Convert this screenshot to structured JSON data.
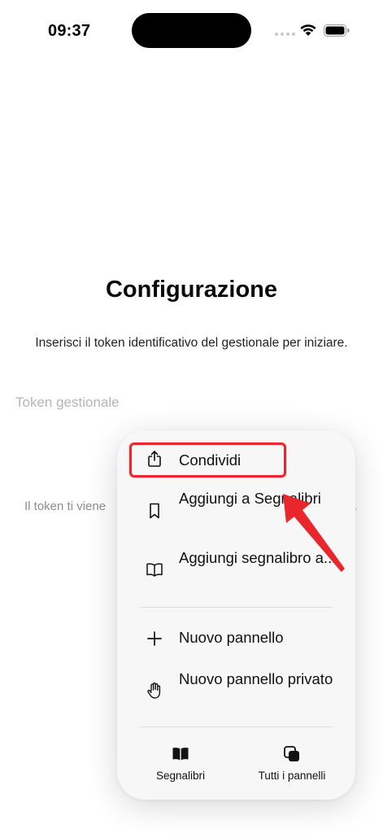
{
  "status_bar": {
    "time": "09:37",
    "icons": [
      "cellular-signal-icon",
      "wifi-icon",
      "battery-icon"
    ]
  },
  "page": {
    "title": "Configurazione",
    "subtitle": "Inserisci il token identificativo del gestionale per iniziare.",
    "token_input": {
      "placeholder": "Token gestionale",
      "value": ""
    },
    "help_text_visible_start": "Il token ti viene",
    "help_text_visible_end": "."
  },
  "context_menu": {
    "items": [
      {
        "label": "Condividi",
        "icon": "share-icon"
      },
      {
        "label": "Aggiungi a Segnalibri",
        "icon": "bookmark-icon"
      },
      {
        "label": "Aggiungi segnalibro a...",
        "icon": "open-book-icon"
      },
      {
        "label": "Nuovo pannello",
        "icon": "plus-icon"
      },
      {
        "label": "Nuovo pannello privato",
        "icon": "hand-icon"
      }
    ],
    "bottom_tabs": [
      {
        "label": "Segnalibri",
        "icon": "bookmarks-book-icon"
      },
      {
        "label": "Tutti i pannelli",
        "icon": "all-tabs-icon"
      }
    ]
  },
  "annotation": {
    "highlight_color": "#e8262b",
    "highlighted_item": "Condividi"
  }
}
